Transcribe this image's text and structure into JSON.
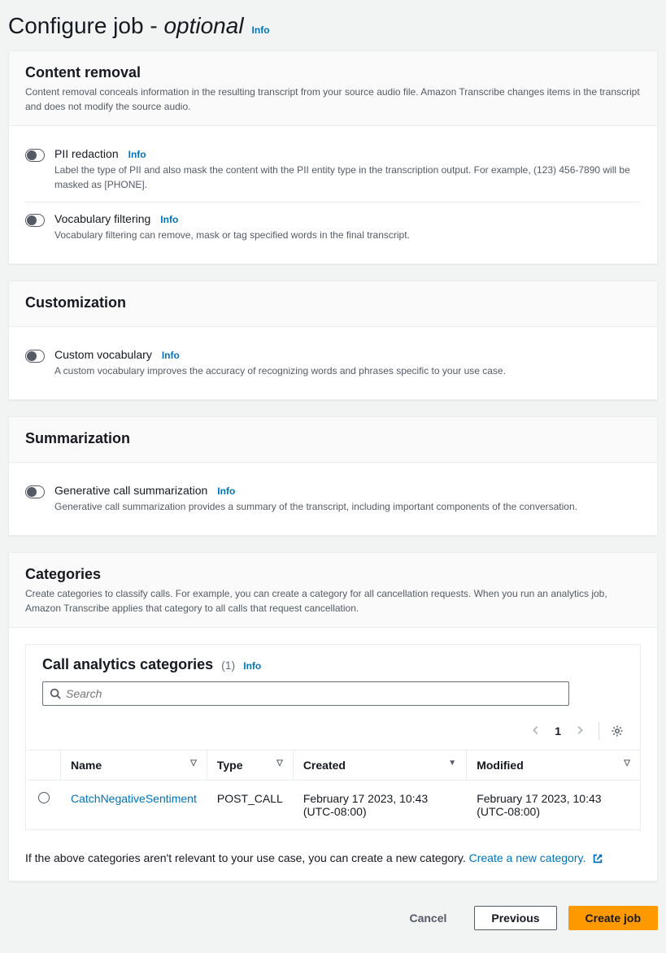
{
  "page": {
    "title_main": "Configure job ",
    "title_dash": "- ",
    "title_optional": "optional",
    "info": "Info"
  },
  "content_removal": {
    "heading": "Content removal",
    "description": "Content removal conceals information in the resulting transcript from your source audio file. Amazon Transcribe changes items in the transcript and does not modify the source audio.",
    "pii": {
      "title": "PII redaction",
      "info": "Info",
      "desc": "Label the type of PII and also mask the content with the PII entity type in the transcription output. For example, (123) 456-7890 will be masked as [PHONE]."
    },
    "vocab": {
      "title": "Vocabulary filtering",
      "info": "Info",
      "desc": "Vocabulary filtering can remove, mask or tag specified words in the final transcript."
    }
  },
  "customization": {
    "heading": "Customization",
    "cv": {
      "title": "Custom vocabulary",
      "info": "Info",
      "desc": "A custom vocabulary improves the accuracy of recognizing words and phrases specific to your use case."
    }
  },
  "summarization": {
    "heading": "Summarization",
    "gs": {
      "title": "Generative call summarization",
      "info": "Info",
      "desc": "Generative call summarization provides a summary of the transcript, including important components of the conversation."
    }
  },
  "categories": {
    "heading": "Categories",
    "description": "Create categories to classify calls. For example, you can create a category for all cancellation requests. When you run an analytics job, Amazon Transcribe applies that category to all calls that request cancellation.",
    "subtitle": "Call analytics categories",
    "count": "(1)",
    "info": "Info",
    "search_placeholder": "Search",
    "page": "1",
    "columns": {
      "name": "Name",
      "type": "Type",
      "created": "Created",
      "modified": "Modified"
    },
    "rows": [
      {
        "name": "CatchNegativeSentiment",
        "type": "POST_CALL",
        "created": "February 17 2023, 10:43 (UTC-08:00)",
        "modified": "February 17 2023, 10:43 (UTC-08:00)"
      }
    ],
    "footer_note_prefix": "If the above categories aren't relevant to your use case, you can create a new category. ",
    "footer_note_link": "Create a new category."
  },
  "actions": {
    "cancel": "Cancel",
    "previous": "Previous",
    "create": "Create job"
  }
}
